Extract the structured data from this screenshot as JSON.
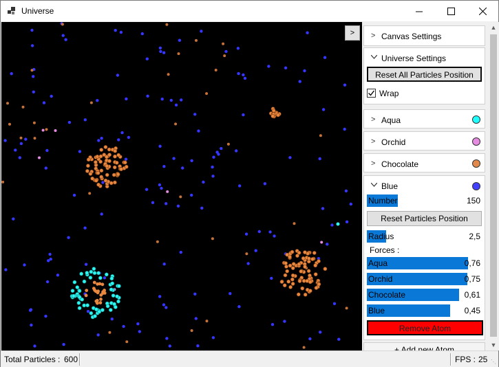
{
  "window": {
    "title": "Universe",
    "icons": [
      "app-icon",
      "minimize-icon",
      "maximize-icon",
      "close-icon"
    ]
  },
  "toggle_label": ">",
  "panel": {
    "canvas_settings": {
      "title": "Canvas Settings",
      "icon": "chevron-right-icon"
    },
    "universe_settings": {
      "title": "Universe Settings",
      "icon": "chevron-down-icon",
      "reset_all_label": "Reset All Particles Position",
      "wrap_label": "Wrap",
      "wrap_checked": true
    },
    "atoms": [
      {
        "name": "Aqua",
        "color": "#1fffff"
      },
      {
        "name": "Orchid",
        "color": "#e58be2"
      },
      {
        "name": "Chocolate",
        "color": "#e1894a"
      }
    ],
    "blue": {
      "title": "Blue",
      "color": "#4141ff",
      "number_label": "Number",
      "number_value": "150",
      "number_fraction": 0.27,
      "reset_label": "Reset Particles Position",
      "radius_label": "Radius",
      "radius_value": "2,5",
      "radius_fraction": 0.17,
      "forces_label": "Forces :",
      "forces": [
        {
          "name": "Aqua",
          "value": "0,76",
          "fraction": 0.88
        },
        {
          "name": "Orchid",
          "value": "0,75",
          "fraction": 0.875
        },
        {
          "name": "Chocolate",
          "value": "0,61",
          "fraction": 0.805
        },
        {
          "name": "Blue",
          "value": "0,45",
          "fraction": 0.725
        }
      ],
      "remove_label": "Remove Atom"
    },
    "add_label": "+ Add new Atom"
  },
  "status": {
    "total_label": "Total Particles :",
    "total_value": "600",
    "fps_label": "FPS :",
    "fps_value": "25"
  },
  "colors": {
    "canvas_bg": "#000000",
    "slider": "#0a78d7",
    "remove": "#ff0000"
  }
}
